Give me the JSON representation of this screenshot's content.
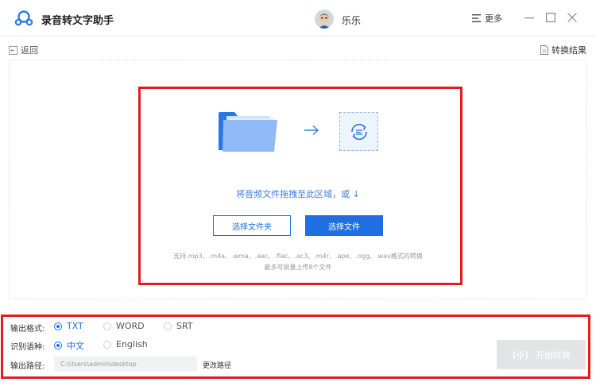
{
  "app": {
    "title": "录音转文字助手"
  },
  "user": {
    "name": "乐乐"
  },
  "menu": {
    "more_label": "更多"
  },
  "nav": {
    "back_label": "返回",
    "result_label": "转换结果"
  },
  "drop": {
    "hint": "将音频文件拖拽至此区域，或 ↓",
    "select_folder": "选择文件夹",
    "select_file": "选择文件",
    "support_text": "支持.mp3、.m4a、.wma、.aac、.flac、.ac3、.m4r、.ape、.ogg、.wav格式的转换",
    "limit_text": "最多可批量上传8个文件"
  },
  "settings": {
    "format_label": "输出格式:",
    "format_options": [
      "TXT",
      "WORD",
      "SRT"
    ],
    "format_selected": "TXT",
    "language_label": "识别语种:",
    "language_options": [
      "中文",
      "English"
    ],
    "language_selected": "中文",
    "path_label": "输出路径:",
    "path_value": "C:\\Users\\admin\\desktop",
    "change_path": "更改路径",
    "start_button": "开始转换"
  },
  "colors": {
    "accent": "#1f6fe0",
    "highlight": "#e01e1e",
    "disabled": "#e3e4e6"
  },
  "icons": [
    "logo-icon",
    "avatar-icon",
    "menu-icon",
    "minimize-icon",
    "maximize-icon",
    "close-icon",
    "back-icon",
    "document-icon",
    "folder-icon",
    "arrow-right-icon",
    "convert-icon",
    "waveform-icon"
  ]
}
